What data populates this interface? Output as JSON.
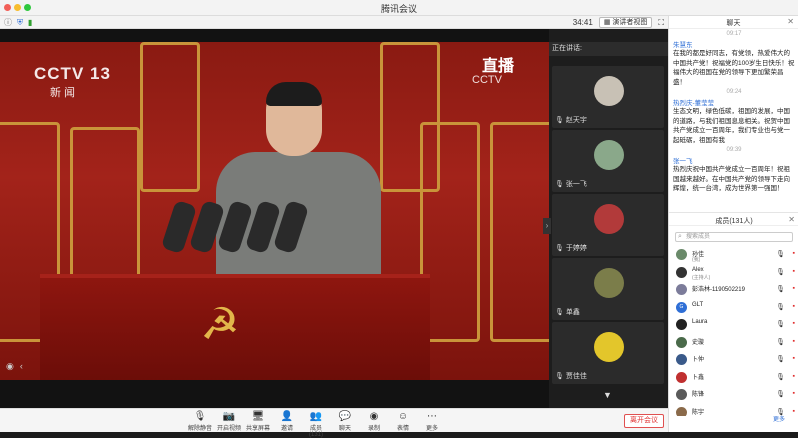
{
  "window": {
    "title": "腾讯会议"
  },
  "topbar": {
    "timer": "34:41",
    "view_button": "演讲者视图"
  },
  "video": {
    "logo_main": "CCTV 13",
    "logo_sub": "新 闻",
    "live_label": "直播",
    "live_sub": "CCTV"
  },
  "strip": {
    "speaking_label": "正在讲话:",
    "tiles": [
      {
        "name": "赵天宇",
        "color": "#c8c1b5"
      },
      {
        "name": "张一飞",
        "color": "#8aa88a"
      },
      {
        "name": "于婷婷",
        "color": "#b23a3a"
      },
      {
        "name": "单鑫",
        "color": "#7b7d4a"
      },
      {
        "name": "贾佳佳",
        "color": "#e3c62b"
      }
    ]
  },
  "bottombar": {
    "tools": [
      {
        "icon": "mic-icon",
        "glyph": "🎙",
        "label": "解除静音"
      },
      {
        "icon": "camera-icon",
        "glyph": "📷",
        "label": "开启视频"
      },
      {
        "icon": "share-icon",
        "glyph": "🖥",
        "label": "共享屏幕"
      },
      {
        "icon": "invite-icon",
        "glyph": "👤",
        "label": "邀请"
      },
      {
        "icon": "members-icon",
        "glyph": "👥",
        "label": "成员(131)"
      },
      {
        "icon": "chat-icon",
        "glyph": "💬",
        "label": "聊天"
      },
      {
        "icon": "record-icon",
        "glyph": "◉",
        "label": "录制"
      },
      {
        "icon": "emoji-icon",
        "glyph": "☺",
        "label": "表情"
      },
      {
        "icon": "more-icon",
        "glyph": "⋯",
        "label": "更多"
      }
    ],
    "end_label": "离开会议"
  },
  "chat": {
    "title": "聊天",
    "messages": [
      {
        "time": "09:17",
        "name": "朱慧东",
        "text": "在我的都是好同志，有党领，热爱伟大的中国共产党！祝福党的100岁生日快乐！祝福伟大的祖国在党的领导下更加繁荣昌盛！"
      },
      {
        "time": "09:24",
        "name": "热烈庆-董莹莹",
        "text": "生态文明，绿色低碳，祖国的发展，中国的道路，与我们祖国息息相关。祝贺中国共产党成立一百周年，我们专业也与党一起砥砺，祖国有我"
      },
      {
        "time": "09:39",
        "name": "张一飞",
        "text": "热烈庆祝中国共产党成立一百周年！祝祖国越来越好。在中国共产党的领导下走向辉煌，统一台湾，成为世界第一强国！"
      }
    ]
  },
  "members": {
    "title": "成员(131人)",
    "search_placeholder": "搜索成员",
    "list": [
      {
        "name": "孙佳",
        "role": "(我)",
        "color": "#6a8a6a"
      },
      {
        "name": "Alex",
        "role": "(主持人)",
        "color": "#333333"
      },
      {
        "name": "彭浩林-1190502219",
        "role": "",
        "color": "#7c7c9a"
      },
      {
        "name": "GLT",
        "role": "",
        "color": "#2f6fd6"
      },
      {
        "name": "Laura",
        "role": "",
        "color": "#222222"
      },
      {
        "name": "史璇",
        "role": "",
        "color": "#4a6a4a"
      },
      {
        "name": "卜仲",
        "role": "",
        "color": "#3a5a8a"
      },
      {
        "name": "卜鑫",
        "role": "",
        "color": "#c03030"
      },
      {
        "name": "陈锋",
        "role": "",
        "color": "#5a5a5a"
      },
      {
        "name": "陈宇",
        "role": "",
        "color": "#8a6a4a"
      }
    ],
    "more_label": "更多"
  }
}
